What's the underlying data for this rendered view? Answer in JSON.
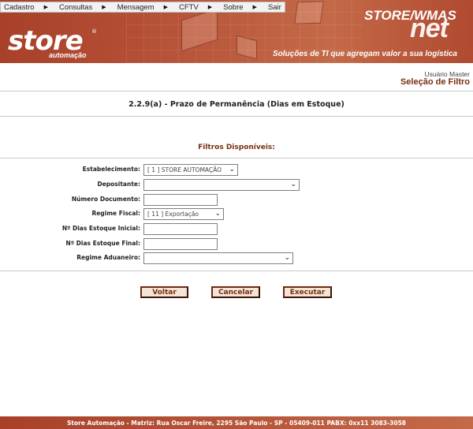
{
  "menu": {
    "items": [
      {
        "label": "Cadastro"
      },
      {
        "label": "Consultas"
      },
      {
        "label": "Mensagem"
      },
      {
        "label": "CFTV"
      },
      {
        "label": "Sobre"
      },
      {
        "label": "Sair"
      }
    ]
  },
  "branding": {
    "logo_text": "store",
    "logo_reg": "®",
    "logo_sub": "automação",
    "product": "STORE/WMAS",
    "product_suffix": "net",
    "tagline": "Soluções de TI que agregam valor a sua logística"
  },
  "colors": {
    "banner": "#b04a30",
    "accent": "#7a2e10",
    "button_bg": "#f3e4d6"
  },
  "header": {
    "user": "Usuário Master",
    "section": "Seleção de Filtro"
  },
  "report": {
    "title": "2.2.9(a) - Prazo de Permanência (Dias em Estoque)"
  },
  "filters": {
    "title": "Filtros Disponíveis:",
    "estabelecimento": {
      "label": "Estabelecimento:",
      "value": "[ 1 ] STORE AUTOMAÇÃO"
    },
    "depositante": {
      "label": "Depositante:",
      "value": ""
    },
    "numero_documento": {
      "label": "Número Documento:",
      "value": ""
    },
    "regime_fiscal": {
      "label": "Regime Fiscal:",
      "value": "[ 11 ] Exportação"
    },
    "dias_inicial": {
      "label": "Nº Dias Estoque Inicial:",
      "value": ""
    },
    "dias_final": {
      "label": "Nº Dias Estoque Final:",
      "value": ""
    },
    "regime_aduaneiro": {
      "label": "Regime Aduaneiro:",
      "value": ""
    }
  },
  "buttons": {
    "voltar": "Voltar",
    "cancelar": "Cancelar",
    "executar": "Executar"
  },
  "icons": {
    "menu_arrow": "triangle-right-icon",
    "select_arrow": "chevron-down-icon"
  },
  "footer": {
    "text": "Store Automação - Matriz: Rua Oscar Freire, 2295 São Paulo - SP - 05409-011 PABX: 0xx11 3083-3058"
  }
}
